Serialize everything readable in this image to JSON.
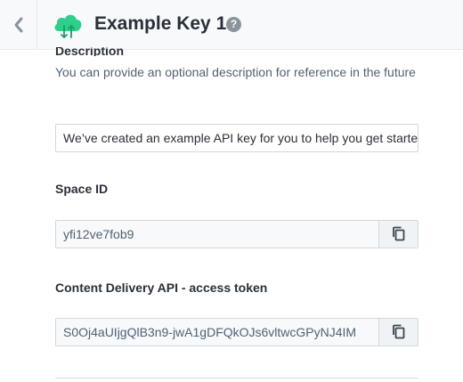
{
  "header": {
    "back_icon": "chevron-left-icon",
    "logo_icon": "cloud-sync-icon",
    "title": "Example Key 1",
    "help_icon": "question-mark-icon",
    "help_glyph": "?"
  },
  "description": {
    "label": "Description",
    "help_text": "You can provide an optional description for reference in the future",
    "value": "We’ve created an example API key for you to help you get started"
  },
  "space_id": {
    "label": "Space ID",
    "value": "yfi12ve7fob9",
    "copy_icon": "copy-icon"
  },
  "cda_token": {
    "label": "Content Delivery API - access token",
    "value": "S0Oj4aUIjgQlB3n9-jwA1gDFQkOJs6vltwcGPyNJ4IM",
    "copy_icon": "copy-icon"
  },
  "colors": {
    "accent_green": "#2ecf8a",
    "header_bg": "#f7f9fa",
    "border": "#cfd9e0"
  }
}
